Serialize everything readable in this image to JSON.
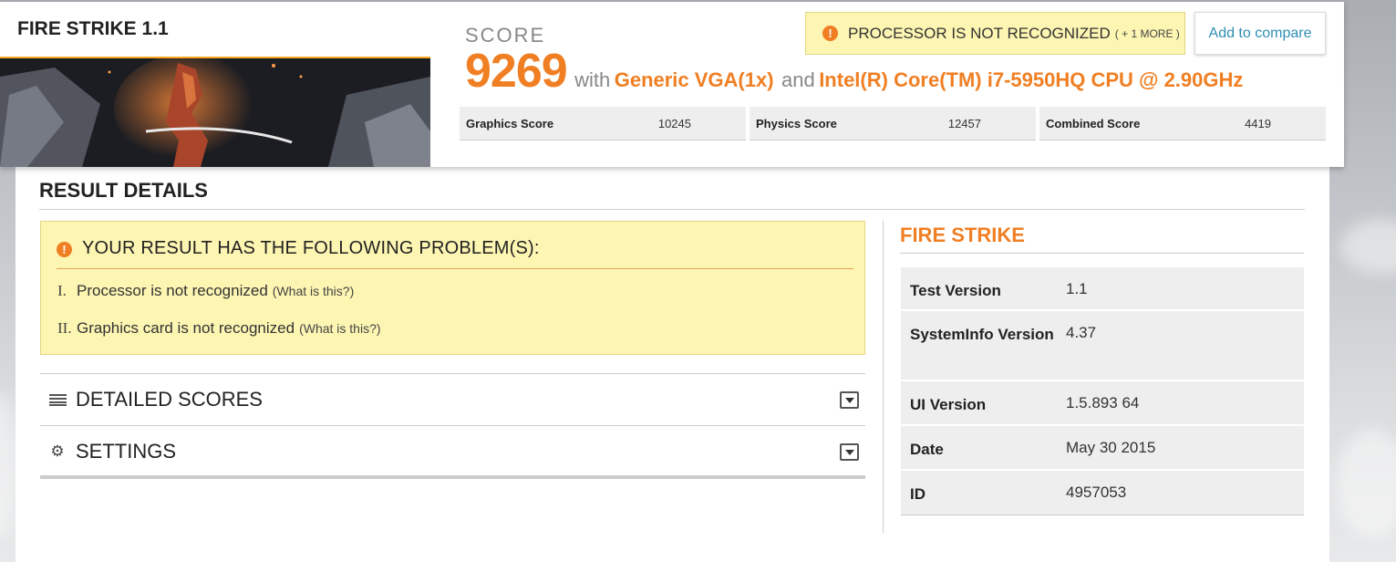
{
  "header": {
    "test_title": "FIRE STRIKE 1.1",
    "score_label": "SCORE",
    "score_value": "9269",
    "with_text": "with",
    "gpu": "Generic VGA(1x)",
    "and_text": "and",
    "cpu": "Intel(R) Core(TM) i7-5950HQ CPU @ 2.90GHz",
    "warning_text": "PROCESSOR IS NOT RECOGNIZED",
    "warning_more": "( + 1 MORE )",
    "compare_label": "Add to compare",
    "subscores": [
      {
        "label": "Graphics Score",
        "value": "10245"
      },
      {
        "label": "Physics Score",
        "value": "12457"
      },
      {
        "label": "Combined Score",
        "value": "4419"
      }
    ]
  },
  "result_details": {
    "title": "RESULT DETAILS",
    "problem_title": "YOUR RESULT HAS THE FOLLOWING PROBLEM(S):",
    "problems": [
      {
        "num": "I.",
        "text": "Processor is not recognized",
        "link": "(What is this?)"
      },
      {
        "num": "II.",
        "text": "Graphics card is not recognized",
        "link": "(What is this?)"
      }
    ],
    "sections": [
      {
        "label": "DETAILED SCORES",
        "icon": "list-icon"
      },
      {
        "label": "SETTINGS",
        "icon": "gear-icon"
      }
    ]
  },
  "fire_strike": {
    "title": "FIRE STRIKE",
    "rows": [
      {
        "key": "Test Version",
        "value": "1.1"
      },
      {
        "key": "SystemInfo Version",
        "value": "4.37"
      },
      {
        "key": "UI Version",
        "value": "1.5.893 64"
      },
      {
        "key": "Date",
        "value": "May 30 2015"
      },
      {
        "key": "ID",
        "value": "4957053"
      }
    ]
  },
  "colors": {
    "accent": "#f07f23",
    "warning_bg": "#fdf5b2",
    "link": "#2f8fb5"
  }
}
